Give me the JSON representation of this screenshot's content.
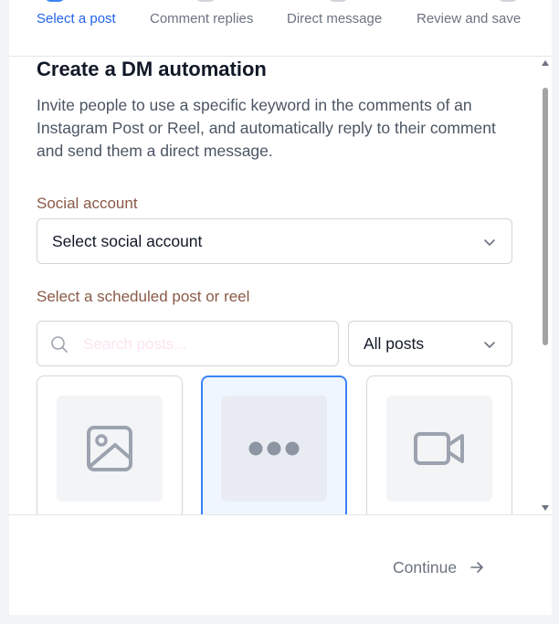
{
  "stepper": {
    "steps": [
      {
        "label": "Select a post",
        "active": true
      },
      {
        "label": "Comment replies",
        "active": false
      },
      {
        "label": "Direct message",
        "active": false
      },
      {
        "label": "Review and save",
        "active": false
      }
    ]
  },
  "main": {
    "title": "Create a DM automation",
    "description": "Invite people to use a specific keyword in the comments of an Instagram Post or Reel, and automatically reply to their comment and send them a direct message.",
    "social_account": {
      "label": "Social account",
      "value": "Select social account"
    },
    "post_picker": {
      "label": "Select a scheduled post or reel",
      "search_placeholder": "Search posts...",
      "filter_value": "All posts",
      "cards": [
        {
          "icon": "image-icon",
          "selected": false
        },
        {
          "icon": "more-dots-icon",
          "selected": true
        },
        {
          "icon": "video-icon",
          "selected": false
        }
      ]
    }
  },
  "footer": {
    "continue_label": "Continue"
  },
  "colors": {
    "accent": "#2563eb",
    "label": "#8a5a48",
    "selected_border": "#3b82f6"
  }
}
